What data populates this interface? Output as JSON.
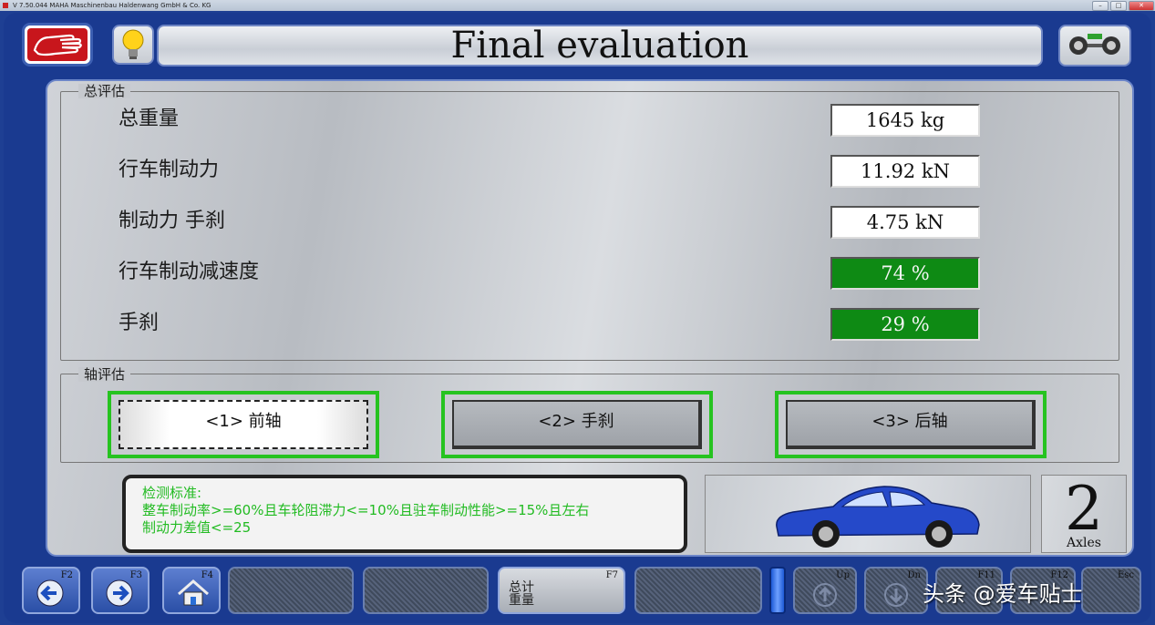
{
  "window": {
    "title": "V 7.50.044   MAHA Maschinenbau Haldenwang GmbH & Co. KG",
    "minimize": "–",
    "maximize": "□",
    "close": "✕"
  },
  "header": {
    "title": "Final evaluation",
    "icons": [
      "hand-stop-icon",
      "lightbulb-icon",
      "axle-wheels-icon"
    ]
  },
  "overall": {
    "group_label": "总评估",
    "rows": [
      {
        "label": "总重量",
        "value": "1645 kg",
        "status": "neutral"
      },
      {
        "label": "行车制动力",
        "value": "11.92 kN",
        "status": "neutral"
      },
      {
        "label": "制动力 手刹",
        "value": "4.75 kN",
        "status": "neutral"
      },
      {
        "label": "行车制动减速度",
        "value": "74 %",
        "status": "pass"
      },
      {
        "label": "手刹",
        "value": "29 %",
        "status": "pass"
      }
    ]
  },
  "axles": {
    "group_label": "轴评估",
    "buttons": [
      {
        "label": "<1> 前轴",
        "selected": true
      },
      {
        "label": "<2> 手刹",
        "selected": false
      },
      {
        "label": "<3> 后轴",
        "selected": false
      }
    ]
  },
  "standards": {
    "line1": "检测标准:",
    "line2": "整车制动率>=60%且车轮阻滞力<=10%且驻车制动性能>=15%且左右",
    "line3": "制动力差值<=25"
  },
  "vehicle": {
    "axle_count": "2",
    "axle_label": "Axles",
    "icon": "blue-car-icon"
  },
  "function_keys": {
    "f2": "F2",
    "f3": "F3",
    "f4": "F4",
    "f7": "F7",
    "f7_text_line1": "总计",
    "f7_text_line2": "重量",
    "up": "Up",
    "down": "Dn",
    "f11": "F11",
    "f12": "F12",
    "esc": "Esc"
  },
  "watermark": "头条 @爱车贴士",
  "colors": {
    "frame": "#1a3a90",
    "pass_green": "#0e8a14",
    "standards_text": "#22bb22",
    "selection_border": "#26c320"
  }
}
